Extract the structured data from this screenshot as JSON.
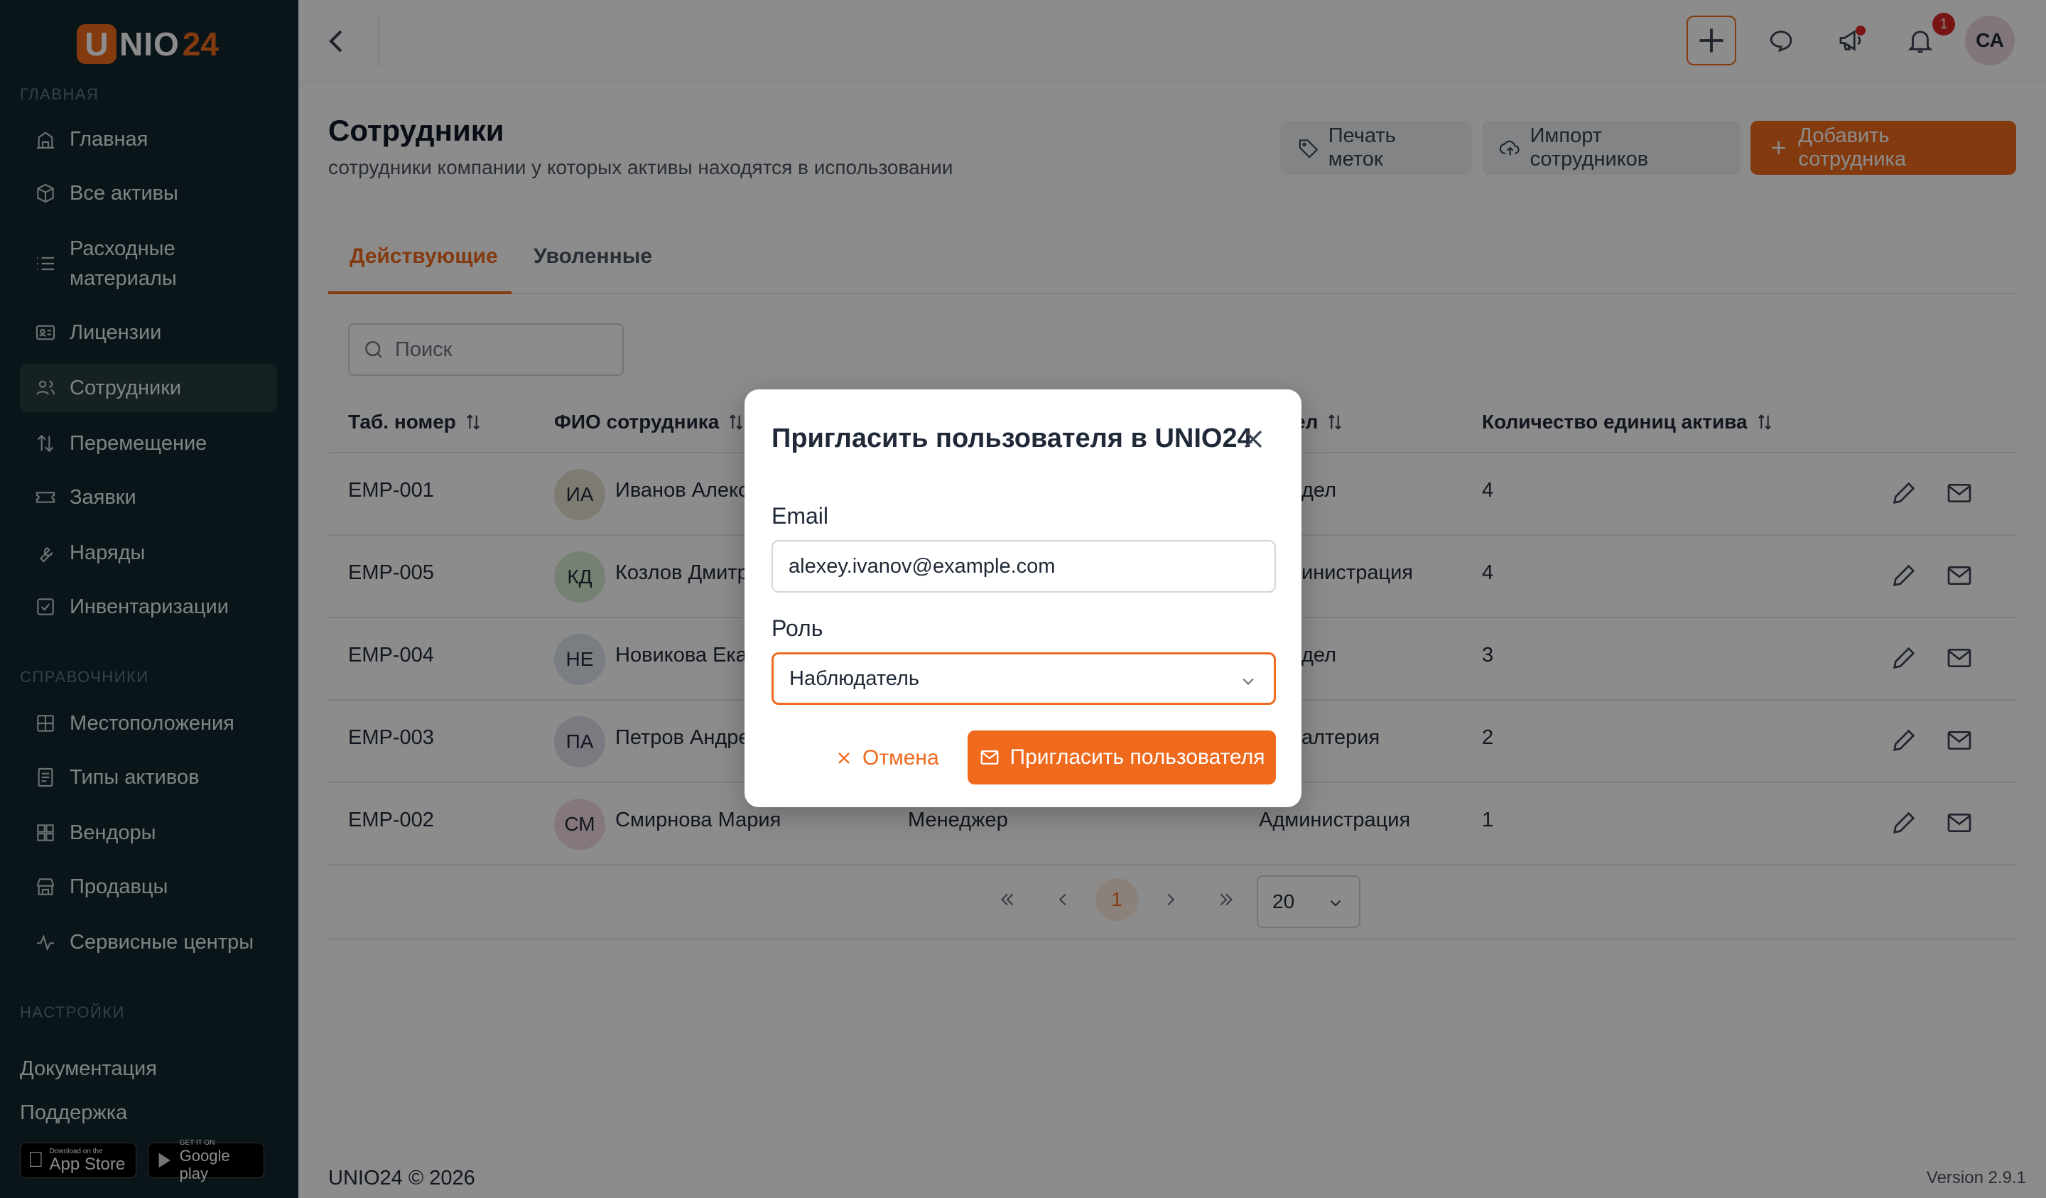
{
  "brand": {
    "logo_u": "U",
    "logo_nio": "NIO",
    "logo_num": "24",
    "accent": "#f06a1d"
  },
  "sidebar": {
    "section_main": "ГЛАВНАЯ",
    "section_refs": "СПРАВОЧНИКИ",
    "section_settings": "НАСТРОЙКИ",
    "items": [
      {
        "label": "Главная",
        "icon": "home-icon"
      },
      {
        "label": "Все активы",
        "icon": "box-icon"
      },
      {
        "label": "Расходные материалы",
        "icon": "list-icon"
      },
      {
        "label": "Лицензии",
        "icon": "id-card-icon"
      },
      {
        "label": "Сотрудники",
        "icon": "users-icon",
        "active": true
      },
      {
        "label": "Перемещение",
        "icon": "arrows-updown-icon"
      },
      {
        "label": "Заявки",
        "icon": "ticket-icon"
      },
      {
        "label": "Наряды",
        "icon": "wrench-icon"
      },
      {
        "label": "Инвентаризации",
        "icon": "checkbox-icon"
      }
    ],
    "ref_items": [
      {
        "label": "Местоположения",
        "icon": "grid-icon"
      },
      {
        "label": "Типы активов",
        "icon": "document-icon"
      },
      {
        "label": "Вендоры",
        "icon": "apps-icon"
      },
      {
        "label": "Продавцы",
        "icon": "store-icon"
      },
      {
        "label": "Сервисные центры",
        "icon": "activity-icon"
      }
    ],
    "docs": "Документация",
    "support": "Поддержка",
    "app_store_small": "Download on the",
    "app_store_big": "App Store",
    "google_small": "GET IT ON",
    "google_big": "Google play"
  },
  "topbar": {
    "notifications_count": "1",
    "avatar_initials": "СА"
  },
  "page": {
    "title": "Сотрудники",
    "subtitle": "сотрудники компании у которых активы находятся в использовании",
    "btn_print": "Печать меток",
    "btn_import": "Импорт сотрудников",
    "btn_add": "Добавить сотрудника",
    "tab_active": "Действующие",
    "tab_fired": "Уволенные",
    "search_placeholder": "Поиск"
  },
  "table": {
    "columns": [
      "Таб. номер",
      "ФИО сотрудника",
      "ел",
      "Количество единиц актива"
    ],
    "rows": [
      {
        "id": "EMP-001",
        "initials": "ИА",
        "name": "Иванов Алекс",
        "dept": "дел",
        "count": "4",
        "avatar_color": "#e6e1cf"
      },
      {
        "id": "EMP-005",
        "initials": "КД",
        "name": "Козлов Дмитр",
        "dept": "инистрация",
        "count": "4",
        "avatar_color": "#d7ebd2"
      },
      {
        "id": "EMP-004",
        "initials": "НЕ",
        "name": "Новикова Ека",
        "dept": "дел",
        "count": "3",
        "avatar_color": "#dfe6ee"
      },
      {
        "id": "EMP-003",
        "initials": "ПА",
        "name": "Петров Андре",
        "dept": "алтерия",
        "count": "2",
        "avatar_color": "#e3dcec"
      },
      {
        "id": "EMP-002",
        "initials": "СМ",
        "name": "Смирнова Мария",
        "position": "Менеджер",
        "dept": "Администрация",
        "count": "1",
        "avatar_color": "#f0dbe2"
      }
    ]
  },
  "pagination": {
    "current": "1",
    "per_page": "20"
  },
  "footer": {
    "copyright": "UNIO24 © 2026",
    "version": "Version 2.9.1"
  },
  "modal": {
    "title": "Пригласить пользователя в UNIO24",
    "email_label": "Email",
    "email_value": "alexey.ivanov@example.com",
    "role_label": "Роль",
    "role_value": "Наблюдатель",
    "cancel": "Отмена",
    "invite": "Пригласить пользователя"
  }
}
